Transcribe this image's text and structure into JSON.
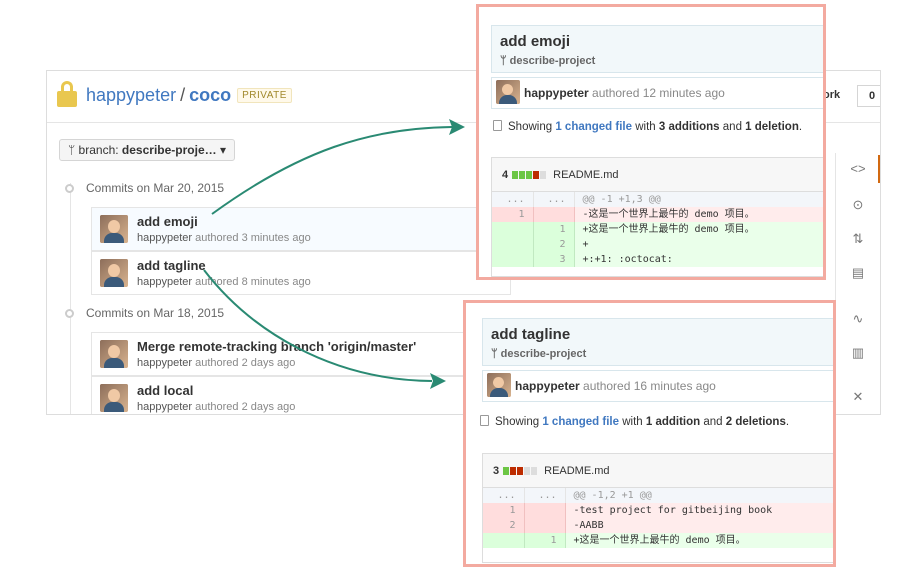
{
  "repo": {
    "owner": "happypeter",
    "separator": "/",
    "name": "coco",
    "visibility_badge": "PRIVATE",
    "fork_label": "ork",
    "fork_count": "0"
  },
  "branch_selector": {
    "prefix": "branch:",
    "value": "describe-proje…",
    "caret": "▾"
  },
  "commit_groups": [
    {
      "date_label": "Commits on Mar 20, 2015",
      "commits": [
        {
          "title": "add emoji",
          "author": "happypeter",
          "meta": "authored 3 minutes ago"
        },
        {
          "title": "add tagline",
          "author": "happypeter",
          "meta": "authored 8 minutes ago"
        }
      ]
    },
    {
      "date_label": "Commits on Mar 18, 2015",
      "commits": [
        {
          "title": "Merge remote-tracking branch 'origin/master'",
          "author": "happypeter",
          "meta": "authored 2 days ago"
        },
        {
          "title": "add local",
          "author": "happypeter",
          "meta": "authored 2 days ago"
        }
      ]
    }
  ],
  "side_nav_icons": [
    "code-icon",
    "issue-icon",
    "pull-request-icon",
    "wiki-icon",
    "pulse-icon",
    "graph-icon",
    "settings-icon"
  ],
  "popup_emoji": {
    "title": "add emoji",
    "branch": "describe-project",
    "author": "happypeter",
    "author_meta": "authored 12 minutes ago",
    "summary": {
      "prefix": "Showing",
      "link": "1 changed file",
      "mid": "with",
      "adds": "3 additions",
      "and": "and",
      "dels": "1 deletion",
      "end": "."
    },
    "file": {
      "changes": "4",
      "name": "README.md",
      "blocks": [
        "g",
        "g",
        "g",
        "r",
        "n"
      ],
      "lines": [
        {
          "type": "hunk",
          "old": "...",
          "new": "...",
          "code": "@@ -1 +1,3 @@"
        },
        {
          "type": "del",
          "old": "1",
          "new": "",
          "code": "-这是一个世界上最牛的 demo 项目。"
        },
        {
          "type": "add",
          "old": "",
          "new": "1",
          "code": "+这是一个世界上最牛的 demo 项目。"
        },
        {
          "type": "add",
          "old": "",
          "new": "2",
          "code": "+"
        },
        {
          "type": "add",
          "old": "",
          "new": "3",
          "code": "+:+1: :octocat:"
        }
      ]
    }
  },
  "popup_tagline": {
    "title": "add tagline",
    "branch": "describe-project",
    "author": "happypeter",
    "author_meta": "authored 16 minutes ago",
    "summary": {
      "prefix": "Showing",
      "link": "1 changed file",
      "mid": "with",
      "adds": "1 addition",
      "and": "and",
      "dels": "2 deletions",
      "end": "."
    },
    "file": {
      "changes": "3",
      "name": "README.md",
      "blocks": [
        "g",
        "r",
        "r",
        "n",
        "n"
      ],
      "lines": [
        {
          "type": "hunk",
          "old": "...",
          "new": "...",
          "code": "@@ -1,2 +1 @@"
        },
        {
          "type": "del",
          "old": "1",
          "new": "",
          "code": "-test project for gitbeijing book"
        },
        {
          "type": "del",
          "old": "2",
          "new": "",
          "code": "-AABB"
        },
        {
          "type": "add",
          "old": "",
          "new": "1",
          "code": "+这是一个世界上最牛的 demo 项目。"
        }
      ]
    }
  },
  "colors": {
    "arrow": "#2a8a73",
    "popup_border": "#f3aaa0",
    "link": "#4078c0",
    "lock": "#e9c74f"
  }
}
